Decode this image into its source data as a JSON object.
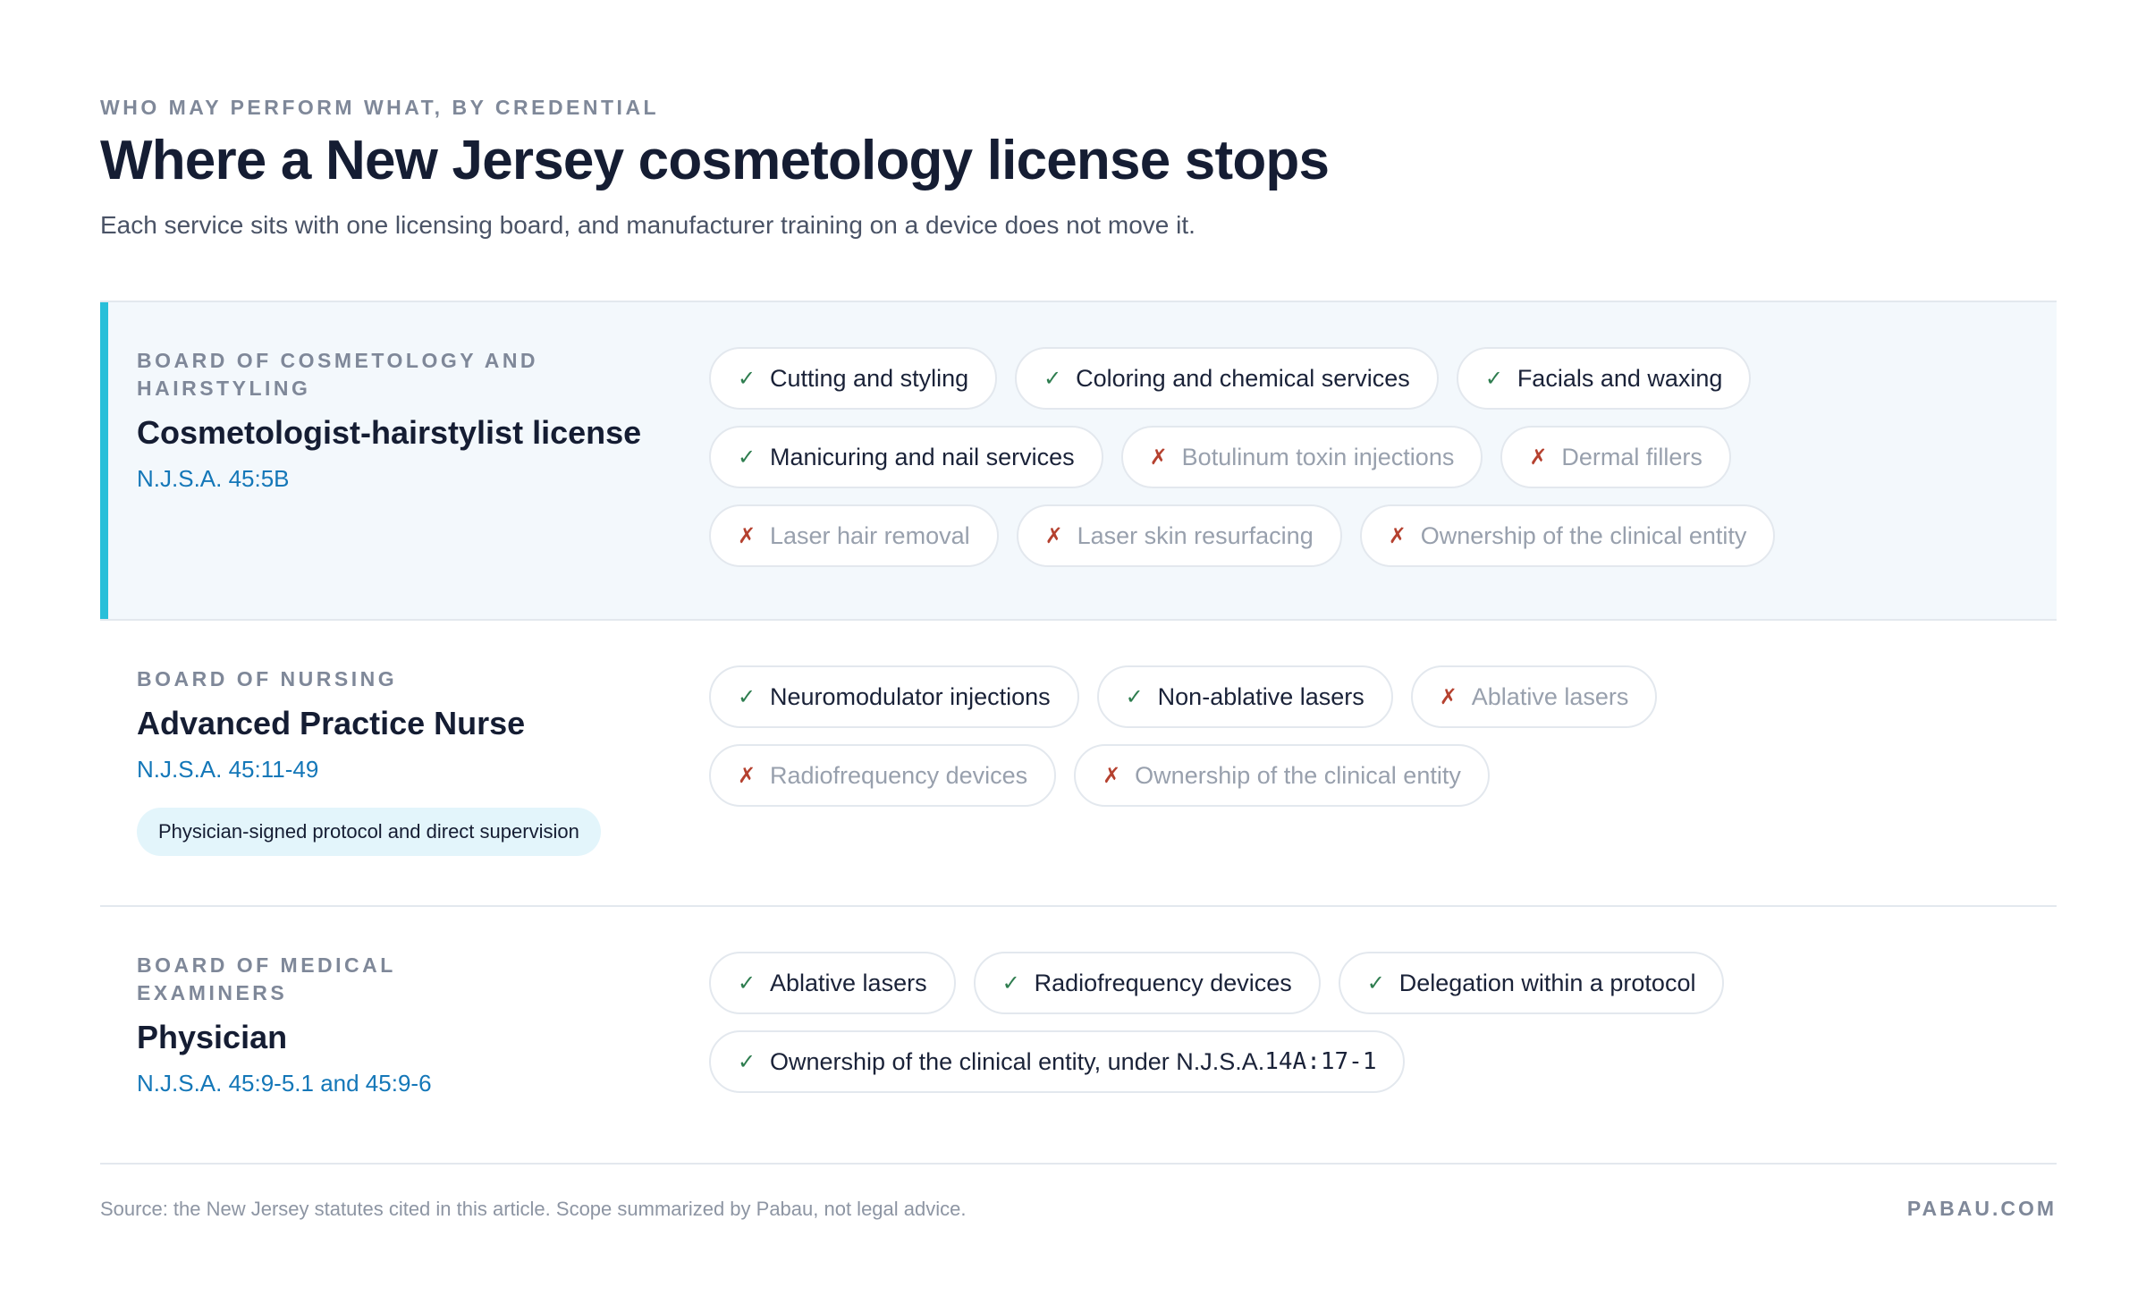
{
  "header": {
    "eyebrow": "WHO MAY PERFORM WHAT, BY CREDENTIAL",
    "title": "Where a New Jersey cosmetology license stops",
    "subtitle": "Each service sits with one licensing board, and manufacturer training on a device does not move it."
  },
  "rows": [
    {
      "board": "BOARD OF COSMETOLOGY AND HAIRSTYLING",
      "license": "Cosmetologist-hairstylist license",
      "statute": "N.J.S.A. 45:5B",
      "services": [
        {
          "label": "Cutting and styling",
          "allowed": true
        },
        {
          "label": "Coloring and chemical services",
          "allowed": true
        },
        {
          "label": "Facials and waxing",
          "allowed": true
        },
        {
          "label": "Manicuring and nail services",
          "allowed": true
        },
        {
          "label": "Botulinum toxin injections",
          "allowed": false
        },
        {
          "label": "Dermal fillers",
          "allowed": false
        },
        {
          "label": "Laser hair removal",
          "allowed": false
        },
        {
          "label": "Laser skin resurfacing",
          "allowed": false
        },
        {
          "label": "Ownership of the clinical entity",
          "allowed": false
        }
      ]
    },
    {
      "board": "BOARD OF NURSING",
      "license": "Advanced Practice Nurse",
      "statute": "N.J.S.A. 45:11-49",
      "note": "Physician-signed protocol and direct supervision",
      "services": [
        {
          "label": "Neuromodulator injections",
          "allowed": true
        },
        {
          "label": "Non-ablative lasers",
          "allowed": true
        },
        {
          "label": "Ablative lasers",
          "allowed": false
        },
        {
          "label": "Radiofrequency devices",
          "allowed": false
        },
        {
          "label": "Ownership of the clinical entity",
          "allowed": false
        }
      ]
    },
    {
      "board": "BOARD OF MEDICAL EXAMINERS",
      "license": "Physician",
      "statute": "N.J.S.A. 45:9-5.1 and 45:9-6",
      "services": [
        {
          "label": "Ablative lasers",
          "allowed": true
        },
        {
          "label": "Radiofrequency devices",
          "allowed": true
        },
        {
          "label": "Delegation within a protocol",
          "allowed": true
        },
        {
          "label": "Ownership of the clinical entity, under N.J.S.A. ",
          "code": "14A:17-1",
          "allowed": true
        }
      ]
    }
  ],
  "marks": {
    "yes": "✓",
    "no": "✗"
  },
  "footer": {
    "source": "Source: the New Jersey statutes cited in this article. Scope summarized by Pabau, not legal advice.",
    "brand": "PABAU.COM"
  }
}
